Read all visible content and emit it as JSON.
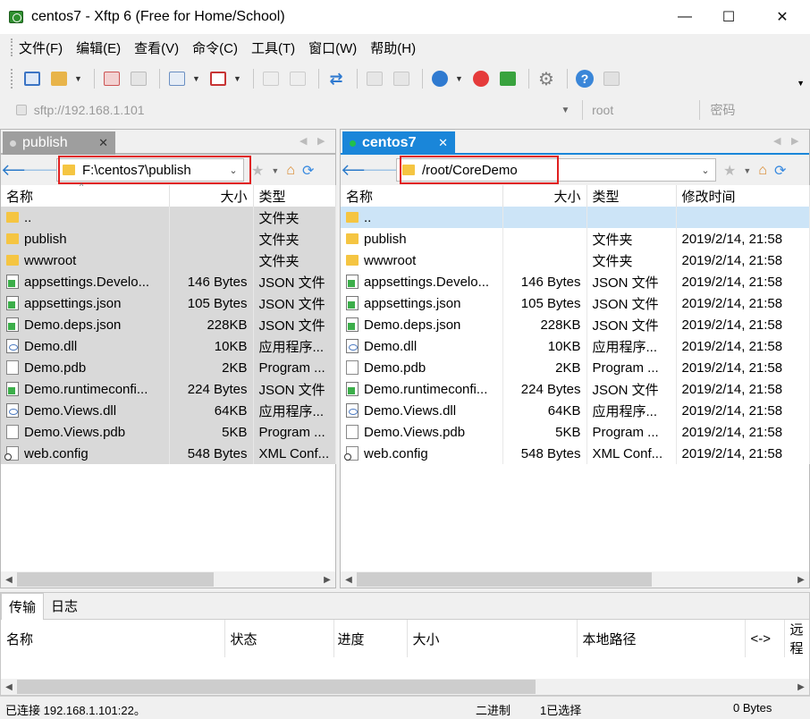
{
  "window": {
    "title": "centos7 - Xftp 6 (Free for Home/School)",
    "minimize_glyph": "—",
    "maximize_glyph": "☐",
    "close_glyph": "✕"
  },
  "menu": [
    "文件(F)",
    "编辑(E)",
    "查看(V)",
    "命令(C)",
    "工具(T)",
    "窗口(W)",
    "帮助(H)"
  ],
  "toolbar": {
    "icons": [
      "new-session-icon",
      "open-folder-icon",
      "disconnect-icon",
      "reconnect-icon",
      "properties-icon",
      "transfer-icon",
      "new-file-icon",
      "copy-icon",
      "sync-icon",
      "delete-icon",
      "paste-icon",
      "encoding-icon",
      "xshell-icon",
      "xftp-icon",
      "options-icon",
      "help-icon",
      "chat-icon"
    ]
  },
  "address": {
    "host_placeholder": "sftp://192.168.1.101",
    "user_placeholder": "root",
    "password_placeholder": "密码"
  },
  "left_panel": {
    "tab_label": "publish",
    "path": "F:\\centos7\\publish",
    "columns": [
      "名称",
      "大小",
      "类型"
    ],
    "rows": [
      {
        "name": "..",
        "size": "",
        "type": "文件夹",
        "icon": "folder"
      },
      {
        "name": "publish",
        "size": "",
        "type": "文件夹",
        "icon": "folder"
      },
      {
        "name": "wwwroot",
        "size": "",
        "type": "文件夹",
        "icon": "folder"
      },
      {
        "name": "appsettings.Develo...",
        "size": "146 Bytes",
        "type": "JSON 文件",
        "icon": "json"
      },
      {
        "name": "appsettings.json",
        "size": "105 Bytes",
        "type": "JSON 文件",
        "icon": "json"
      },
      {
        "name": "Demo.deps.json",
        "size": "228KB",
        "type": "JSON 文件",
        "icon": "json"
      },
      {
        "name": "Demo.dll",
        "size": "10KB",
        "type": "应用程序...",
        "icon": "dll"
      },
      {
        "name": "Demo.pdb",
        "size": "2KB",
        "type": "Program ...",
        "icon": "doc"
      },
      {
        "name": "Demo.runtimeconfi...",
        "size": "224 Bytes",
        "type": "JSON 文件",
        "icon": "json"
      },
      {
        "name": "Demo.Views.dll",
        "size": "64KB",
        "type": "应用程序...",
        "icon": "dll"
      },
      {
        "name": "Demo.Views.pdb",
        "size": "5KB",
        "type": "Program ...",
        "icon": "doc"
      },
      {
        "name": "web.config",
        "size": "548 Bytes",
        "type": "XML Conf...",
        "icon": "cfg"
      }
    ]
  },
  "right_panel": {
    "tab_label": "centos7",
    "path": "/root/CoreDemo",
    "columns": [
      "名称",
      "大小",
      "类型",
      "修改时间"
    ],
    "rows": [
      {
        "name": "..",
        "size": "",
        "type": "",
        "modified": "",
        "icon": "folder"
      },
      {
        "name": "publish",
        "size": "",
        "type": "文件夹",
        "modified": "2019/2/14, 21:58",
        "icon": "folder"
      },
      {
        "name": "wwwroot",
        "size": "",
        "type": "文件夹",
        "modified": "2019/2/14, 21:58",
        "icon": "folder"
      },
      {
        "name": "appsettings.Develo...",
        "size": "146 Bytes",
        "type": "JSON 文件",
        "modified": "2019/2/14, 21:58",
        "icon": "json"
      },
      {
        "name": "appsettings.json",
        "size": "105 Bytes",
        "type": "JSON 文件",
        "modified": "2019/2/14, 21:58",
        "icon": "json"
      },
      {
        "name": "Demo.deps.json",
        "size": "228KB",
        "type": "JSON 文件",
        "modified": "2019/2/14, 21:58",
        "icon": "json"
      },
      {
        "name": "Demo.dll",
        "size": "10KB",
        "type": "应用程序...",
        "modified": "2019/2/14, 21:58",
        "icon": "dll"
      },
      {
        "name": "Demo.pdb",
        "size": "2KB",
        "type": "Program ...",
        "modified": "2019/2/14, 21:58",
        "icon": "doc"
      },
      {
        "name": "Demo.runtimeconfi...",
        "size": "224 Bytes",
        "type": "JSON 文件",
        "modified": "2019/2/14, 21:58",
        "icon": "json"
      },
      {
        "name": "Demo.Views.dll",
        "size": "64KB",
        "type": "应用程序...",
        "modified": "2019/2/14, 21:58",
        "icon": "dll"
      },
      {
        "name": "Demo.Views.pdb",
        "size": "5KB",
        "type": "Program ...",
        "modified": "2019/2/14, 21:58",
        "icon": "doc"
      },
      {
        "name": "web.config",
        "size": "548 Bytes",
        "type": "XML Conf...",
        "modified": "2019/2/14, 21:58",
        "icon": "cfg"
      }
    ]
  },
  "transfer": {
    "tabs": [
      "传输",
      "日志"
    ],
    "columns": [
      "名称",
      "状态",
      "进度",
      "大小",
      "本地路径",
      "<->",
      "远程"
    ]
  },
  "status": {
    "connection": "已连接 192.168.1.101:22。",
    "mode": "二进制",
    "selected": "1已选择",
    "size": "0 Bytes"
  },
  "colors": {
    "accent": "#1a86d9",
    "highlight_box": "#e02020",
    "left_selection": "#d9d9d9",
    "right_selection": "#cce4f7"
  }
}
